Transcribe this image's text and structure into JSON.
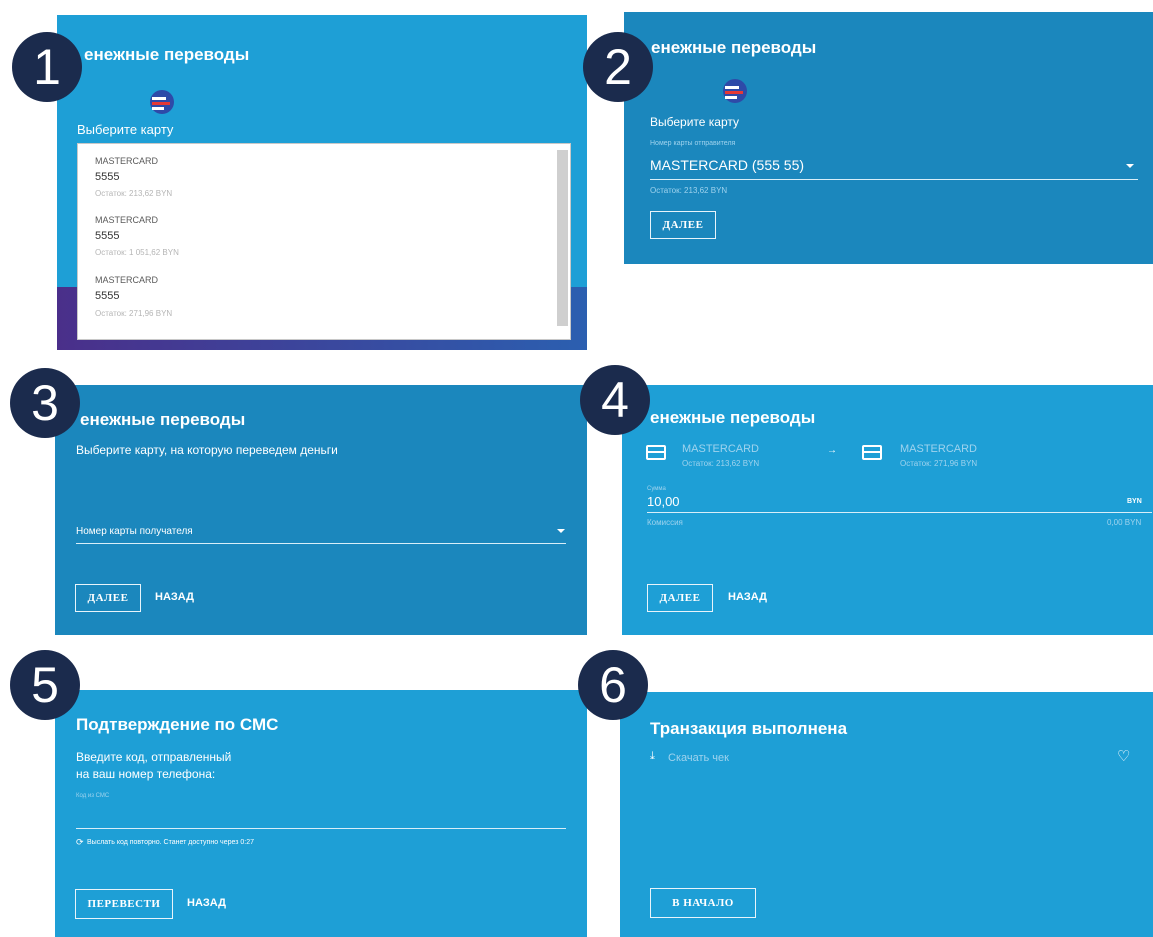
{
  "screens": [
    {
      "step": "1",
      "title": "енежные переводы",
      "choose_card": "Выберите карту",
      "options": [
        {
          "brand": "MASTERCARD",
          "number": "5555",
          "balance": "Остаток: 213,62 BYN"
        },
        {
          "brand": "MASTERCARD",
          "number": "5555",
          "balance": "Остаток: 1 051,62 BYN"
        },
        {
          "brand": "MASTERCARD",
          "number": "5555",
          "balance": "Остаток: 271,96 BYN"
        }
      ]
    },
    {
      "step": "2",
      "title": "енежные переводы",
      "choose_card": "Выберите карту",
      "sender_label": "Номер карты отправителя",
      "selected_card": "MASTERCARD (555 55)",
      "balance": "Остаток: 213,62 BYN",
      "next": "ДАЛЕЕ"
    },
    {
      "step": "3",
      "title": "енежные переводы",
      "instruction": "Выберите карту, на которую переведем деньги",
      "recipient_placeholder": "Номер карты получателя",
      "next": "ДАЛЕЕ",
      "back": "НАЗАД"
    },
    {
      "step": "4",
      "title": "енежные переводы",
      "from_card": {
        "brand": "MASTERCARD",
        "balance": "Остаток: 213,62 BYN"
      },
      "arrow": "→",
      "to_card": {
        "brand": "MASTERCARD",
        "balance": "Остаток: 271,96 BYN"
      },
      "amount_label": "Сумма",
      "amount": "10,00",
      "currency": "BYN",
      "commission_label": "Комиссия",
      "commission": "0,00 BYN",
      "next": "ДАЛЕЕ",
      "back": "НАЗАД"
    },
    {
      "step": "5",
      "title": "Подтверждение по СМС",
      "instruction_line1": "Введите код, отправленный",
      "instruction_line2": "на ваш номер телефона:",
      "code_label": "Код из СМС",
      "resend": "Выслать код повторно. Станет доступно через 0:27",
      "transfer": "ПЕРЕВЕСТИ",
      "back": "НАЗАД"
    },
    {
      "step": "6",
      "title": "Транзакция выполнена",
      "download": "Скачать чек",
      "start": "В НАЧАЛО"
    }
  ],
  "colors": {
    "panel_light": "#1e9fd6",
    "panel_dark": "#1b87bd",
    "badge": "#1b2b4d"
  }
}
